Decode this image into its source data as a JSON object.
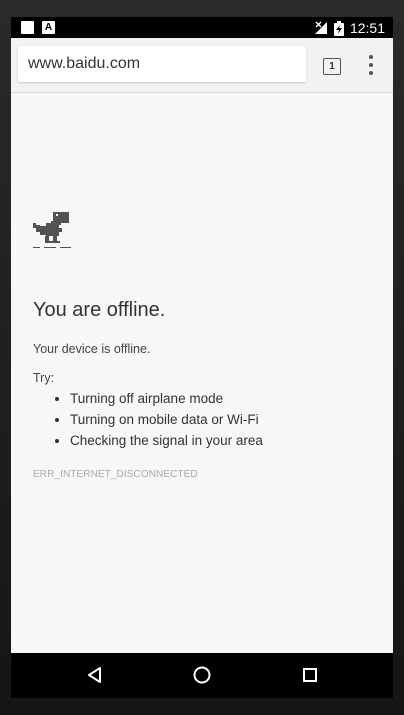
{
  "status_bar": {
    "time": "12:51",
    "icons": [
      "notification-square-icon",
      "a-badge-icon",
      "no-signal-icon",
      "battery-charging-icon"
    ],
    "a_badge_text": "A"
  },
  "toolbar": {
    "url": "www.baidu.com",
    "tab_count": "1",
    "menu_icon": "three-dot-menu-icon"
  },
  "error_page": {
    "icon": "offline-dino-icon",
    "title": "You are offline.",
    "subtitle": "Your device is offline.",
    "try_label": "Try:",
    "suggestions": [
      "Turning off airplane mode",
      "Turning on mobile data or Wi-Fi",
      "Checking the signal in your area"
    ],
    "error_code": "ERR_INTERNET_DISCONNECTED"
  },
  "navigation": {
    "buttons": [
      "back-icon",
      "home-icon",
      "recent-apps-icon"
    ]
  },
  "colors": {
    "background": "#f7f7f7",
    "toolbar": "#f2f2f2",
    "status_bar": "#000000",
    "text_primary": "#333333",
    "text_secondary": "#aaaaaa"
  }
}
